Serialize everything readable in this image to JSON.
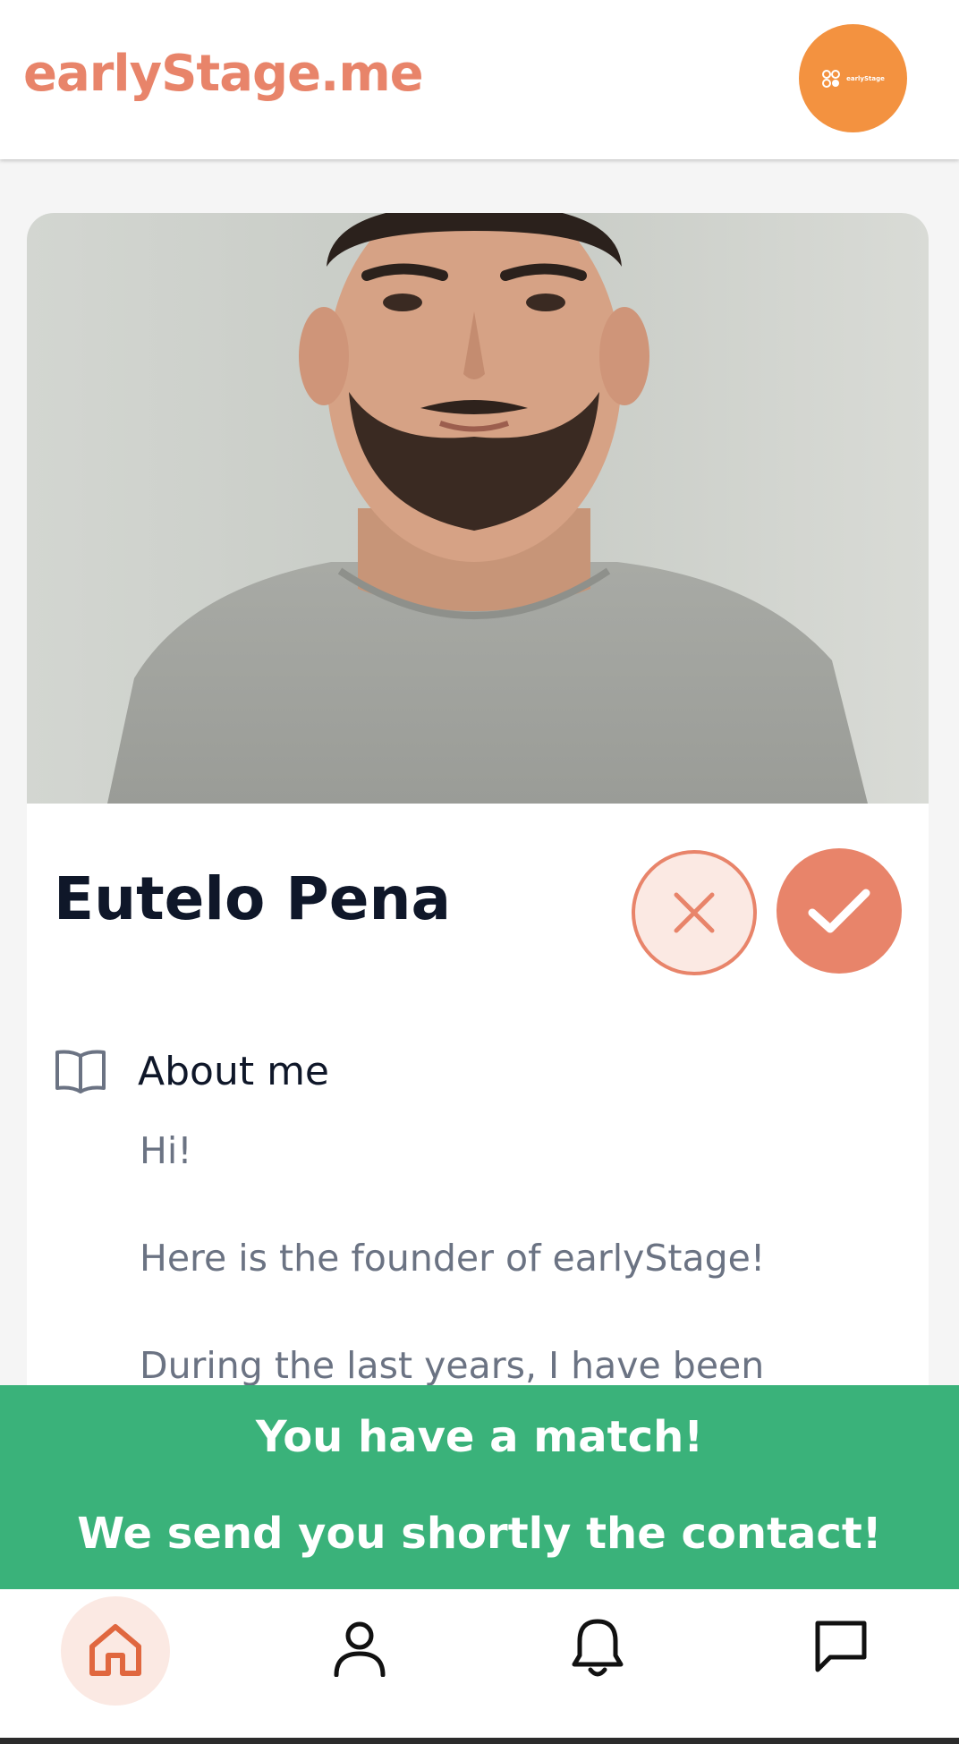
{
  "header": {
    "logo": "earlyStage.me",
    "avatar_label": "earlyStage"
  },
  "profile": {
    "name": "Eutelo Pena",
    "about_title": "About me",
    "about_paragraphs": [
      "Hi!",
      "Here is the founder of earlyStage!",
      "During the last years, I have been"
    ]
  },
  "match_banner": {
    "line1": "You have a match!",
    "line2": "We send you shortly the contact!"
  },
  "nav": {
    "items": [
      "home-icon",
      "user-icon",
      "bell-icon",
      "chat-icon"
    ],
    "active": "home"
  },
  "colors": {
    "brand": "#e8846a",
    "avatar_bg": "#f39240",
    "match_green": "#3ab27a",
    "name_text": "#0f1729",
    "body_text": "#6b7383"
  }
}
